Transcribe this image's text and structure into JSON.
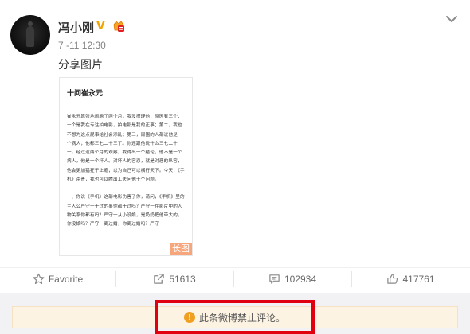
{
  "post": {
    "username": "冯小刚",
    "verified_mark": "V",
    "time": "7 -11 12:30",
    "text": "分享图片",
    "image": {
      "title": "十问崔永元",
      "paragraphs": [
        "崔永元愿张地闹腾了两个月，我没搭理他，原因有三个：一个是我在专注拍电影，拍电影是我的正事；第二，我也不想为这点屁事给社会添乱；第三，周围的人都说他是一个病人，他都三七二十三了。你还跟他说什么三七二十一。经过近两个月的观察，我得出一个结论，他不是一个病人，他是一个坏人。对坏人的容忍，就是对恶的纵容，他会更加猖狂于上瘾，以为自己可以横行天下。今天，《手机》杀青，我也可以腾出工夫问他十个问题。",
        "一、你说《手机》这部电影伤害了你，请问，《手机》里的主人公严守一干过的事你都干过吗？严守一在影片中的人物关系你都有吗？严守一从小没娘，是奶奶把他带大的，你没娘吗？严守一离过婚，你离过婚吗？严守一"
      ],
      "tag": "长图"
    }
  },
  "actions": {
    "favorite": "Favorite",
    "forward_count": "51613",
    "comment_count": "102934",
    "like_count": "417761"
  },
  "notice": {
    "icon": "!",
    "text": "此条微博禁止评论。"
  },
  "colors": {
    "highlight_border": "#e0000f",
    "notice_bg": "#fdf3e3",
    "warn_icon": "#f0a020",
    "long_tag": "#f7a57a"
  }
}
